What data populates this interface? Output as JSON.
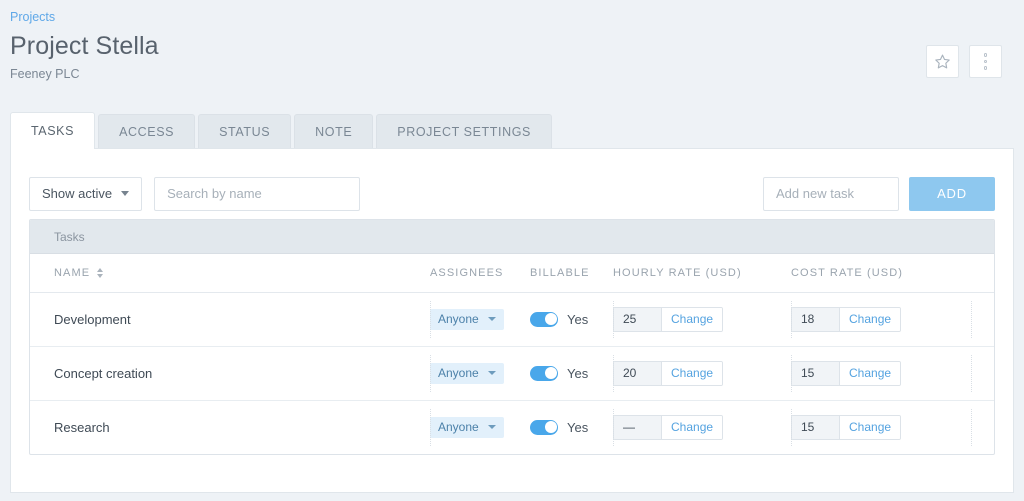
{
  "header": {
    "breadcrumb": "Projects",
    "title": "Project Stella",
    "subtitle": "Feeney PLC",
    "favorite_icon": "star-icon",
    "more_icon": "dots-vertical-icon"
  },
  "tabs": [
    {
      "label": "TASKS",
      "active": true
    },
    {
      "label": "ACCESS",
      "active": false
    },
    {
      "label": "STATUS",
      "active": false
    },
    {
      "label": "NOTE",
      "active": false
    },
    {
      "label": "PROJECT SETTINGS",
      "active": false
    }
  ],
  "toolbar": {
    "filter_label": "Show active",
    "search_placeholder": "Search by name",
    "search_value": "",
    "newtask_placeholder": "Add new task",
    "newtask_value": "",
    "add_label": "ADD"
  },
  "table": {
    "band_title": "Tasks",
    "columns": {
      "name": "NAME",
      "assignees": "ASSIGNEES",
      "billable": "BILLABLE",
      "hourly_rate": "HOURLY RATE (USD)",
      "cost_rate": "COST RATE (USD)"
    },
    "sort": {
      "column": "NAME",
      "icon": "sort-arrows-icon"
    },
    "change_label": "Change",
    "rows": [
      {
        "name": "Development",
        "assignee": "Anyone",
        "billable": true,
        "billable_label": "Yes",
        "hourly_rate": "25",
        "cost_rate": "18"
      },
      {
        "name": "Concept creation",
        "assignee": "Anyone",
        "billable": true,
        "billable_label": "Yes",
        "hourly_rate": "20",
        "cost_rate": "15"
      },
      {
        "name": "Research",
        "assignee": "Anyone",
        "billable": true,
        "billable_label": "Yes",
        "hourly_rate": "—",
        "cost_rate": "15"
      }
    ]
  },
  "colors": {
    "page_bg": "#eef2f6",
    "link": "#5fa8e8",
    "accent": "#49a7ea",
    "add_button": "#8ec8ef",
    "chip_bg": "#e2f0fb",
    "chip_text": "#4c81a9",
    "band_bg": "#e2e8ed"
  }
}
